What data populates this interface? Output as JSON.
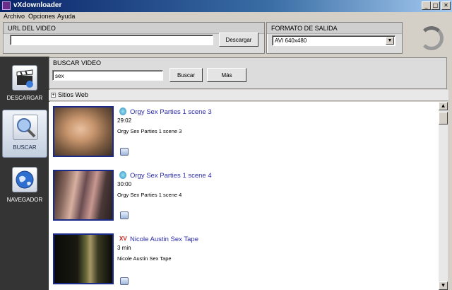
{
  "app": {
    "title": "vXdownloader"
  },
  "window_buttons": {
    "minimize": "_",
    "maximize": "□",
    "close": "✕"
  },
  "menu": [
    "Archivo",
    "Opciones",
    "Ayuda"
  ],
  "url_panel": {
    "heading": "URL DEL VIDEO",
    "value": "",
    "button": "Descargar"
  },
  "format_panel": {
    "heading": "FORMATO DE SALIDA",
    "selected": "AVI 640x480"
  },
  "sidebar": {
    "items": [
      {
        "label": "DESCARGAR",
        "icon": "clapperboard-icon",
        "active": false
      },
      {
        "label": "BUSCAR",
        "icon": "magnifier-icon",
        "active": true
      },
      {
        "label": "NAVEGADOR",
        "icon": "globe-icon",
        "active": false
      }
    ]
  },
  "search": {
    "heading": "BUSCAR VIDEO",
    "query": "sex",
    "button": "Buscar",
    "more_button": "Más"
  },
  "sites": {
    "label": "Sitios Web",
    "toggle": "+"
  },
  "results": [
    {
      "site_icon": "swirl-icon",
      "title": "Orgy Sex Parties 1 scene 3",
      "duration": "29:02",
      "description": "Orgy Sex Parties 1 scene 3"
    },
    {
      "site_icon": "swirl-icon",
      "title": "Orgy Sex Parties 1 scene 4",
      "duration": "30:00",
      "description": "Orgy Sex Parties 1 scene 4"
    },
    {
      "site_icon": "xv-icon",
      "site_text": "XV",
      "title": "Nicole Austin Sex Tape",
      "duration": "3 min",
      "description": "Nicole Austin Sex Tape"
    }
  ],
  "scrollbar": {
    "up": "▲",
    "down": "▼"
  },
  "colors": {
    "title_bar": "#0a246a",
    "link": "#2a2aa8",
    "sidebar": "#343434",
    "thumb_border": "#1a2b8a"
  }
}
